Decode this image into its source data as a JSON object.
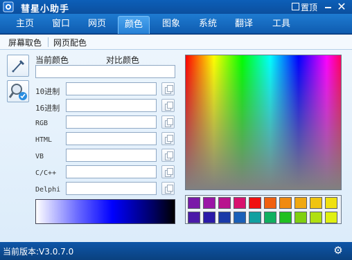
{
  "window": {
    "title": "彗星小助手",
    "pin_label": "置顶",
    "close_glyph": "✕"
  },
  "tabs": [
    {
      "label": "主页"
    },
    {
      "label": "窗口"
    },
    {
      "label": "网页"
    },
    {
      "label": "颜色",
      "active": true
    },
    {
      "label": "图象"
    },
    {
      "label": "系统"
    },
    {
      "label": "翻译"
    },
    {
      "label": "工具"
    }
  ],
  "subtabs": [
    {
      "label": "屏幕取色"
    },
    {
      "label": "网页配色"
    }
  ],
  "tools": {
    "eyedropper": "eyedropper-icon",
    "magnifier": "magnifier-icon"
  },
  "color_panel": {
    "current_label": "当前颜色",
    "compare_label": "对比颜色",
    "fields": [
      {
        "label": "10进制",
        "value": ""
      },
      {
        "label": "16进制",
        "value": ""
      },
      {
        "label": "RGB",
        "value": ""
      },
      {
        "label": "HTML",
        "value": ""
      },
      {
        "label": "VB",
        "value": ""
      },
      {
        "label": "C/C++",
        "value": ""
      },
      {
        "label": "Delphi",
        "value": ""
      }
    ]
  },
  "swatch_colors": [
    "#7a1aa8",
    "#9a16a6",
    "#b8148e",
    "#d8126e",
    "#f01010",
    "#f06010",
    "#f08a10",
    "#f0a810",
    "#f0c410",
    "#f0e010",
    "#4a1aa8",
    "#2a1aa8",
    "#1a3aa8",
    "#1a60b8",
    "#10a0a0",
    "#10b060",
    "#20c020",
    "#80d010",
    "#b0e010",
    "#e0f010"
  ],
  "status": {
    "version_text": "当前版本:V3.0.7.0",
    "settings_icon": "gear-icon"
  }
}
